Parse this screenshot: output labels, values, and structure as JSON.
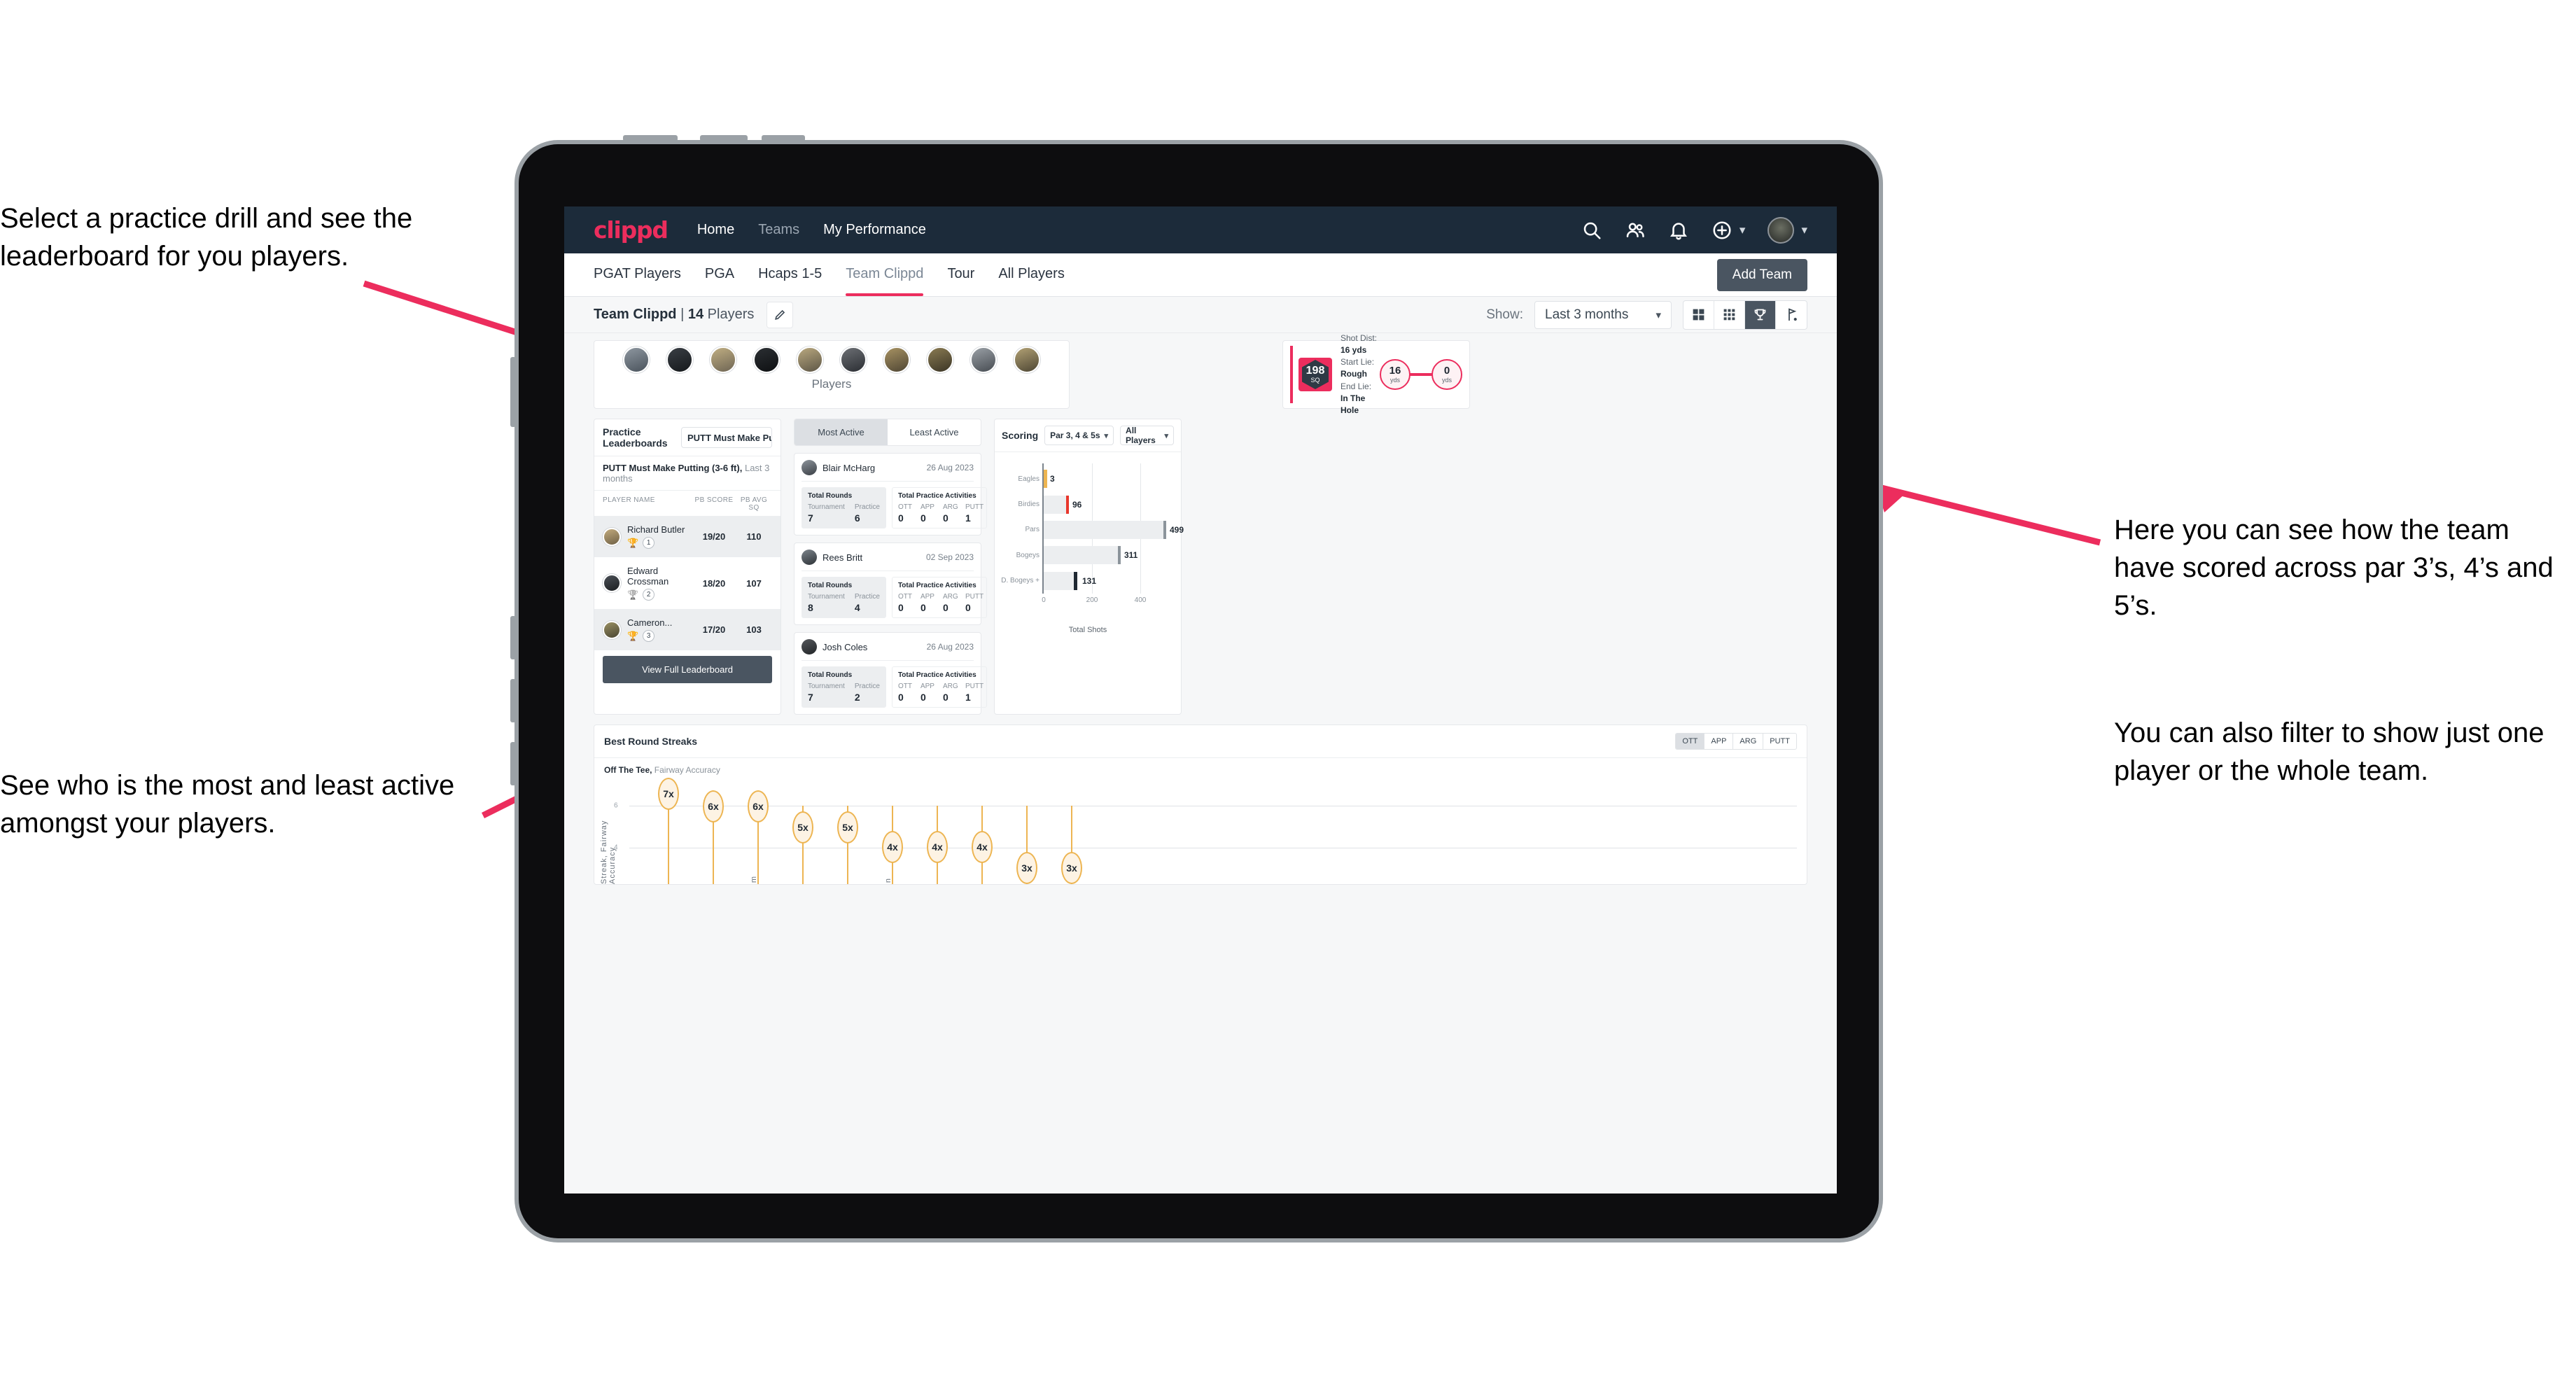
{
  "annotations": {
    "left_top": "Select a practice drill and see the leaderboard for you players.",
    "left_bottom": "See who is the most and least active amongst your players.",
    "right_top": "Here you can see how the team have scored across par 3’s, 4’s and 5’s.",
    "right_bottom": "You can also filter to show just one player or the whole team."
  },
  "topnav": {
    "logo": "clippd",
    "links": [
      {
        "label": "Home",
        "dim": false
      },
      {
        "label": "Teams",
        "dim": true
      },
      {
        "label": "My Performance",
        "dim": false
      }
    ],
    "icons": [
      "search-icon",
      "people-icon",
      "bell-icon",
      "plus-circle-icon",
      "avatar"
    ],
    "accent": "#ec2d5d",
    "bg": "#1c2b3a"
  },
  "tabs": [
    {
      "label": "PGAT Players",
      "active": false
    },
    {
      "label": "PGA",
      "active": false
    },
    {
      "label": "Hcaps 1-5",
      "active": false
    },
    {
      "label": "Team Clippd",
      "active": true
    },
    {
      "label": "Tour",
      "active": false
    },
    {
      "label": "All Players",
      "active": false
    }
  ],
  "add_team_label": "Add Team",
  "team_strip": {
    "team_name": "Team Clippd",
    "separator": "|",
    "player_count": "14",
    "players_word": "Players",
    "edit_icon": "pencil-icon",
    "show_label": "Show:",
    "show_value": "Last 3 months",
    "view_toggles": [
      {
        "icon": "grid-large-icon",
        "selected": false
      },
      {
        "icon": "grid-small-icon",
        "selected": false
      },
      {
        "icon": "trophy-icon",
        "selected": true
      },
      {
        "icon": "flag-icon",
        "selected": false
      }
    ]
  },
  "players_card": {
    "caption": "Players",
    "avatar_count": 10
  },
  "shot_card": {
    "badge_value": "198",
    "badge_unit": "SQ",
    "lines": [
      {
        "key": "Shot Dist:",
        "value": "16 yds"
      },
      {
        "key": "Start Lie:",
        "value": "Rough"
      },
      {
        "key": "End Lie:",
        "value": "In The Hole"
      }
    ],
    "start_dist": "16",
    "start_unit": "yds",
    "end_dist": "0",
    "end_unit": "yds"
  },
  "leaderboard": {
    "title": "Practice Leaderboards",
    "drill_select": "PUTT Must Make Putting ...",
    "subtitle_bold": "PUTT Must Make Putting (3-6 ft),",
    "subtitle_light": "Last 3 months",
    "columns": [
      "PLAYER NAME",
      "PB SCORE",
      "PB AVG SQ"
    ],
    "rows": [
      {
        "name": "Richard Butler",
        "rank": "1",
        "trophy": "gold",
        "score": "19/20",
        "avg": "110"
      },
      {
        "name": "Edward Crossman",
        "rank": "2",
        "trophy": "silver",
        "score": "18/20",
        "avg": "107"
      },
      {
        "name": "Cameron...",
        "rank": "3",
        "trophy": "bronze",
        "score": "17/20",
        "avg": "103"
      }
    ],
    "button_label": "View Full Leaderboard"
  },
  "activity": {
    "segments": [
      {
        "label": "Most Active",
        "on": true
      },
      {
        "label": "Least Active",
        "on": false
      }
    ],
    "rounds_title": "Total Rounds",
    "rounds_keys": [
      "Tournament",
      "Practice"
    ],
    "acts_title": "Total Practice Activities",
    "acts_keys": [
      "OTT",
      "APP",
      "ARG",
      "PUTT"
    ],
    "players": [
      {
        "name": "Blair McHarg",
        "date": "26 Aug 2023",
        "rounds": [
          "7",
          "6"
        ],
        "acts": [
          "0",
          "0",
          "0",
          "1"
        ]
      },
      {
        "name": "Rees Britt",
        "date": "02 Sep 2023",
        "rounds": [
          "8",
          "4"
        ],
        "acts": [
          "0",
          "0",
          "0",
          "0"
        ]
      },
      {
        "name": "Josh Coles",
        "date": "26 Aug 2023",
        "rounds": [
          "7",
          "2"
        ],
        "acts": [
          "0",
          "0",
          "0",
          "1"
        ]
      }
    ]
  },
  "scoring": {
    "title": "Scoring",
    "par_select": "Par 3, 4 & 5s",
    "player_select": "All Players"
  },
  "streaks": {
    "title": "Best Round Streaks",
    "segments": [
      {
        "label": "OTT",
        "on": true
      },
      {
        "label": "APP",
        "on": false
      },
      {
        "label": "ARG",
        "on": false
      },
      {
        "label": "PUTT",
        "on": false
      }
    ],
    "sub_bold": "Off The Tee,",
    "sub_light": "Fairway Accuracy"
  },
  "chart_data": [
    {
      "type": "bar",
      "orientation": "horizontal",
      "title": "Scoring",
      "categories": [
        "Eagles",
        "Birdies",
        "Pars",
        "Bogeys",
        "D. Bogeys +"
      ],
      "values": [
        3,
        96,
        499,
        311,
        131
      ],
      "cap_colors": [
        "#edb552",
        "#e8372c",
        "#8c949b",
        "#8c949b",
        "#1f2832"
      ],
      "xlabel": "Total Shots",
      "ylabel": "",
      "xlim": [
        0,
        560
      ],
      "xticks": [
        0,
        200,
        400
      ],
      "grid": true,
      "legend": "none"
    },
    {
      "type": "scatter",
      "title": "Best Round Streaks",
      "subtitle": "Off The Tee, Fairway Accuracy",
      "ylabel": "Streak, Fairway Accuracy",
      "xlabel": "",
      "ylim": [
        2,
        7.6
      ],
      "yticks": [
        4,
        6
      ],
      "labels": [
        "7x",
        "6x",
        "6x",
        "5x",
        "5x",
        "4x",
        "4x",
        "4x",
        "3x",
        "3x"
      ],
      "values": [
        7,
        6,
        6,
        5,
        5,
        4,
        4,
        4,
        3,
        3
      ],
      "grid": true,
      "marker_fill": "#fdf3e4",
      "marker_stroke": "#edb552"
    }
  ]
}
